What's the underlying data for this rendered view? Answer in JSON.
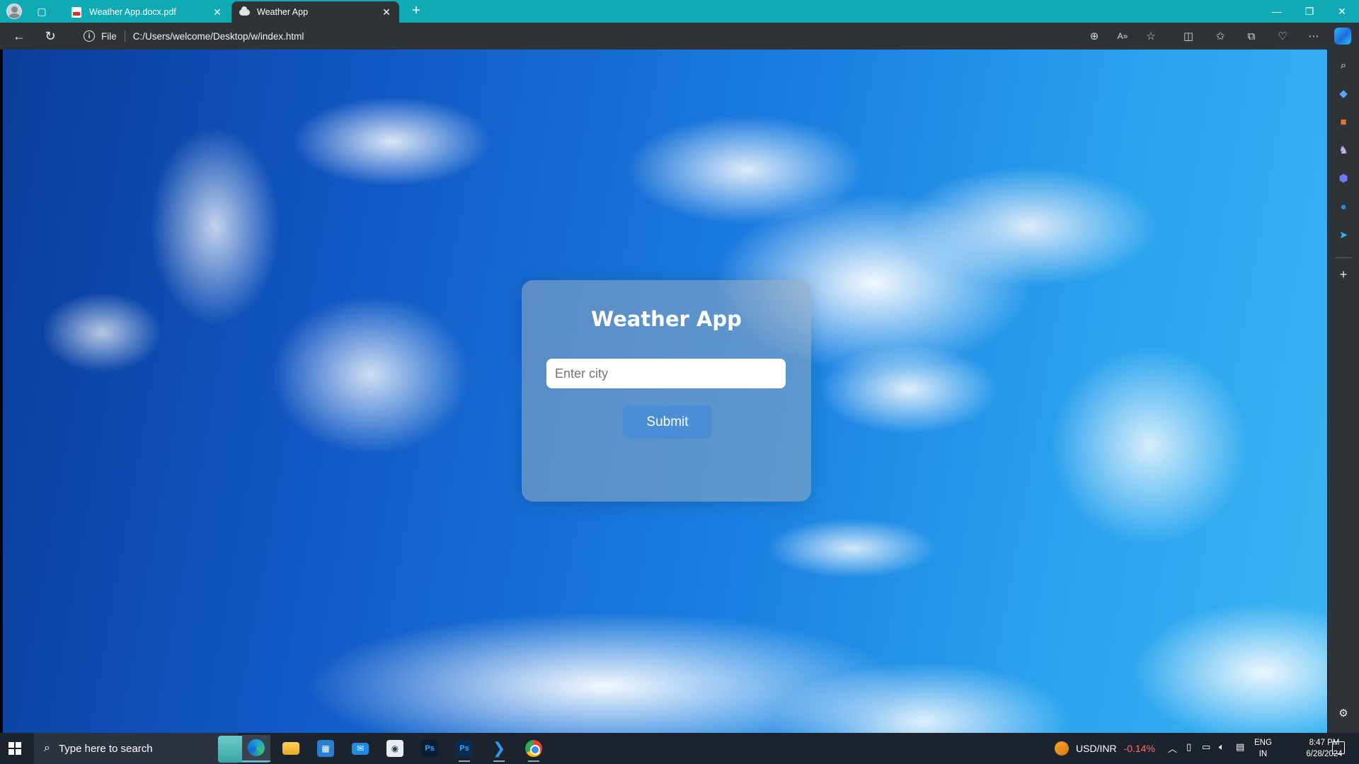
{
  "browser": {
    "tabs": [
      {
        "title": "Weather App.docx.pdf",
        "favicon": "pdf-icon",
        "active": false
      },
      {
        "title": "Weather App",
        "favicon": "cloud-icon",
        "active": true
      }
    ],
    "address": {
      "scheme_label": "File",
      "url": "C:/Users/welcome/Desktop/w/index.html"
    },
    "accent_color": "#10aab5"
  },
  "app": {
    "title": "Weather App",
    "city_input": {
      "placeholder": "Enter city",
      "value": ""
    },
    "submit_label": "Submit",
    "button_color": "#4a8fd6"
  },
  "taskbar": {
    "search_placeholder": "Type here to search",
    "apps": [
      "edge-icon",
      "file-explorer-icon",
      "store-icon",
      "mail-icon",
      "camera-app-icon",
      "photoshop-icon",
      "photoshop-icon",
      "vscode-icon",
      "chrome-icon"
    ],
    "ticker": {
      "pair": "USD/INR",
      "change": "-0.14%",
      "change_color": "#ff6b6b"
    },
    "language": {
      "line1": "ENG",
      "line2": "IN"
    },
    "clock": {
      "time": "8:47 PM",
      "date": "6/28/2024"
    }
  }
}
